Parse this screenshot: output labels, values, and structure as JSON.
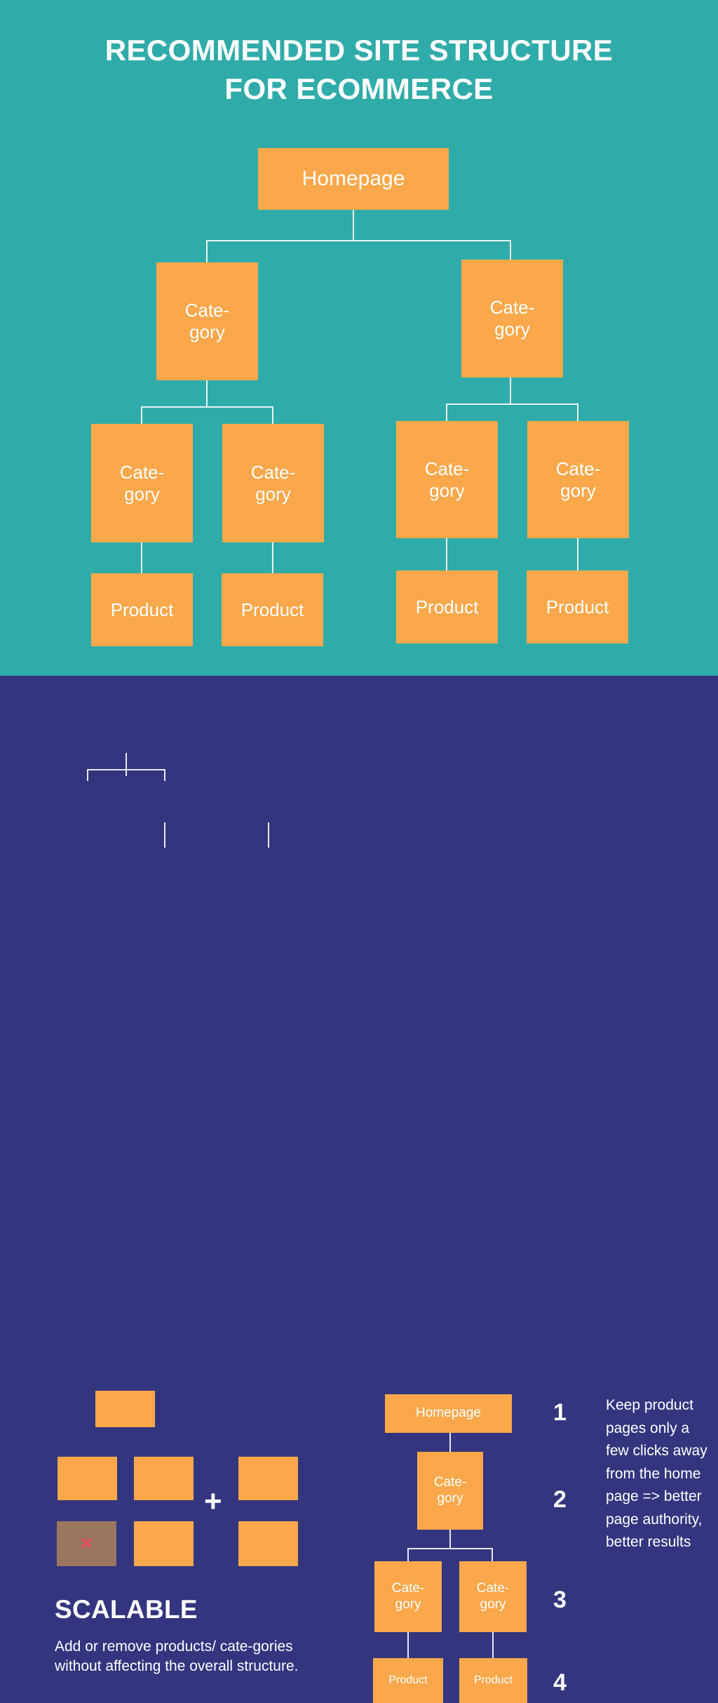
{
  "colors": {
    "teal_bg": "#2FACA9",
    "navy_bg": "#33357E",
    "node_orange": "#FAA84B",
    "node_disabled": "#9A7560",
    "x_red": "#E8485F",
    "line": "#E8F4F3",
    "text_white": "#FFFFFF"
  },
  "title": {
    "line1": "RECOMMENDED SITE STRUCTURE",
    "line2": "FOR ECOMMERCE"
  },
  "labels": {
    "homepage": "Homepage",
    "category": "Cate-\ngory",
    "product": "Product",
    "plus": "+",
    "x": "×"
  },
  "top_diagram": {
    "root": {
      "label": "Homepage"
    },
    "level2": [
      {
        "label": "Cate-\ngory"
      },
      {
        "label": "Cate-\ngory"
      }
    ],
    "level3": [
      {
        "label": "Cate-\ngory"
      },
      {
        "label": "Cate-\ngory"
      },
      {
        "label": "Cate-\ngory"
      },
      {
        "label": "Cate-\ngory"
      }
    ],
    "level4": [
      {
        "label": "Product"
      },
      {
        "label": "Product"
      },
      {
        "label": "Product"
      },
      {
        "label": "Product"
      }
    ]
  },
  "scalable": {
    "heading": "SCALABLE",
    "body": "Add or remove products/ cate-gories without affecting the overall structure.",
    "plus_symbol": "+",
    "removed_marker": "×"
  },
  "depth_diagram": {
    "root": {
      "label": "Homepage"
    },
    "level2": {
      "label": "Cate-\ngory"
    },
    "level3": [
      {
        "label": "Cate-\ngory"
      },
      {
        "label": "Cate-\ngory"
      }
    ],
    "level4": [
      {
        "label": "Product"
      },
      {
        "label": "Product"
      }
    ]
  },
  "steps": [
    {
      "number": "1"
    },
    {
      "number": "2"
    },
    {
      "number": "3"
    },
    {
      "number": "4"
    }
  ],
  "right_note": {
    "text": "Keep product pages only a few clicks away from the home page => better page authority, better results"
  }
}
